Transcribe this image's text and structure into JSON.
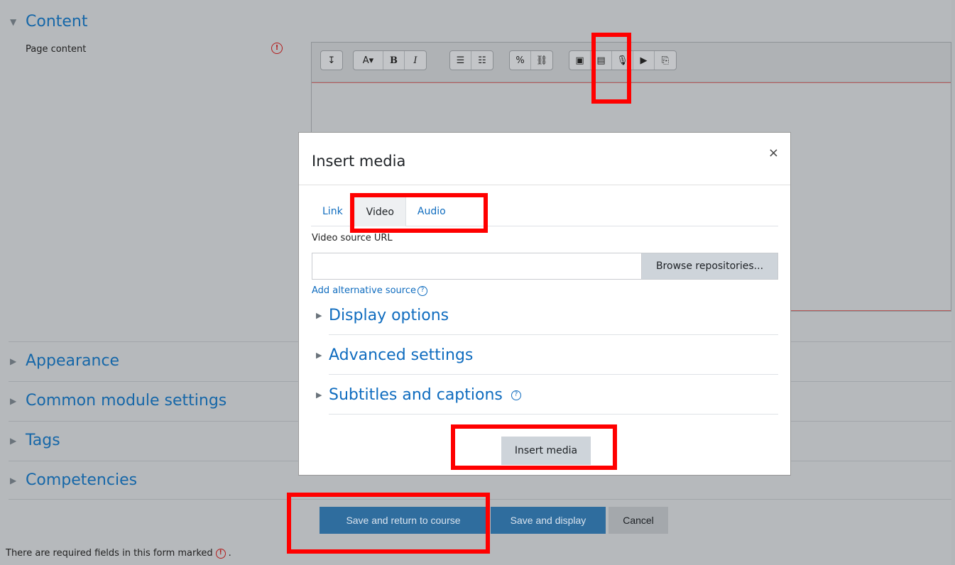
{
  "form": {
    "content_section": "Content",
    "page_content_label": "Page content",
    "required_symbol": "!",
    "appearance_section": "Appearance",
    "common_module_section": "Common module settings",
    "tags_section": "Tags",
    "competencies_section": "Competencies",
    "save_return_label": "Save and return to course",
    "save_display_label": "Save and display",
    "cancel_label": "Cancel",
    "required_note": "There are required fields in this form marked",
    "required_note_end": "."
  },
  "toolbar": {
    "collapse": "↧",
    "font_style": "A▾",
    "bold": "B",
    "italic": "I",
    "unordered_list": "☰",
    "ordered_list": "☷",
    "link": "%",
    "unlink": "⛓",
    "image": "▣",
    "media": "▤",
    "record_audio": "🎙",
    "record_video": "▶",
    "manage_files": "⎘"
  },
  "modal": {
    "title": "Insert media",
    "close": "×",
    "tabs": [
      {
        "label": "Link"
      },
      {
        "label": "Video"
      },
      {
        "label": "Audio"
      }
    ],
    "source_label": "Video source URL",
    "source_value": "",
    "browse_label": "Browse repositories...",
    "alt_source_label": "Add alternative source",
    "help_symbol": "?",
    "display_options": "Display options",
    "advanced_settings": "Advanced settings",
    "subtitles_captions": "Subtitles and captions",
    "insert_label": "Insert media"
  },
  "colors": {
    "highlight": "#ff0000",
    "link": "#0f6cbf",
    "primary": "#2f6d9e"
  }
}
